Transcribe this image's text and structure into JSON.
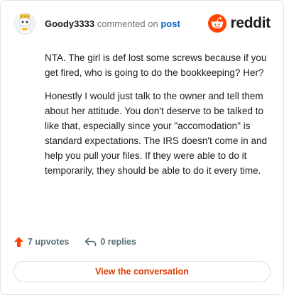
{
  "header": {
    "username": "Goody3333",
    "commented_text": "commented on",
    "post_link": "post",
    "brand": "reddit",
    "avatar_icon": "snoo-avatar-icon",
    "logo_icon": "reddit-logo-icon"
  },
  "comment": {
    "paragraphs": [
      "NTA. The girl is def lost some screws because if you get fired, who is going to do the bookkeeping? Her?",
      "Honestly I would just talk to the owner and tell them about her attitude. You don't deserve to be talked to like that, especially since your \"accomodation\" is standard expectations. The IRS doesn't come in and help you pull your files. If they were able to do it temporarily, they should be able to do it every time."
    ]
  },
  "actions": {
    "upvotes": "7 upvotes",
    "replies": "0 replies",
    "upvote_icon": "upvote-arrow-icon",
    "reply_icon": "reply-arrow-icon"
  },
  "cta": {
    "label": "View the conversation"
  },
  "colors": {
    "accent": "#ff4500",
    "link": "#0a66c2",
    "cta_text": "#d93a00",
    "muted": "#576f76"
  }
}
